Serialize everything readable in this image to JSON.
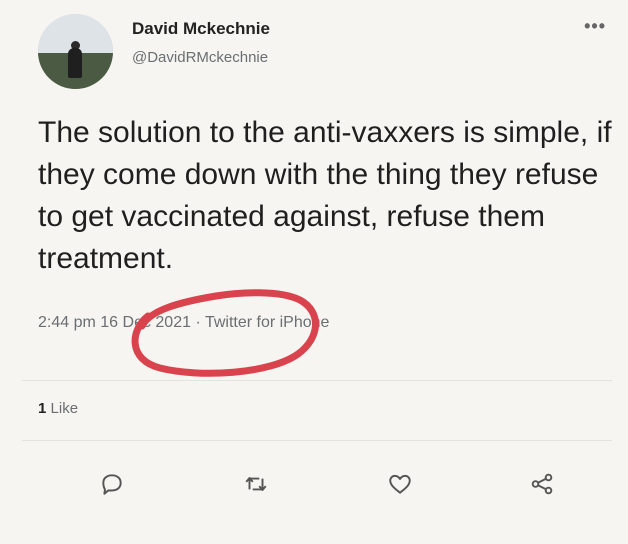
{
  "author": {
    "name": "David Mckechnie",
    "handle": "@DavidRMckechnie"
  },
  "tweet": {
    "text": "The solution to the anti-vaxxers is simple, if they come down with the thing they refuse to get vaccinated against, refuse them treatment.",
    "time": "2:44 pm",
    "date": "16 Dec 2021",
    "separator": "·",
    "source": "Twitter for iPhone"
  },
  "stats": {
    "likes_count": "1",
    "likes_label": "Like"
  },
  "icons": {
    "more": "more-options-icon",
    "reply": "reply-icon",
    "retweet": "retweet-icon",
    "like": "heart-icon",
    "share": "share-icon"
  },
  "colors": {
    "annotation": "#d9434e",
    "muted_text": "#6b6e72",
    "background": "#f6f5f1"
  }
}
